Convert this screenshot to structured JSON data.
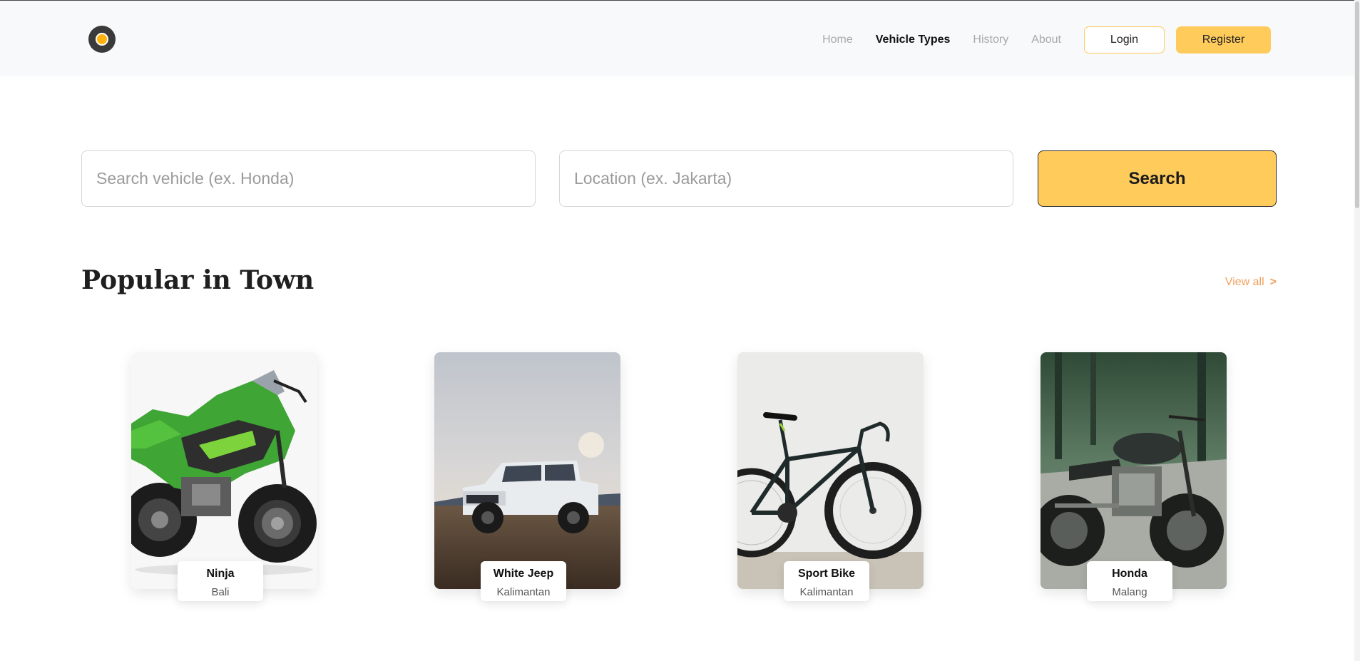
{
  "nav": {
    "items": [
      {
        "label": "Home",
        "active": false
      },
      {
        "label": "Vehicle Types",
        "active": true
      },
      {
        "label": "History",
        "active": false
      },
      {
        "label": "About",
        "active": false
      }
    ],
    "login_label": "Login",
    "register_label": "Register"
  },
  "search": {
    "vehicle_placeholder": "Search vehicle (ex. Honda)",
    "vehicle_value": "",
    "location_placeholder": "Location (ex. Jakarta)",
    "location_value": "",
    "button_label": "Search"
  },
  "popular": {
    "title": "Popular in Town",
    "view_all_label": "View all",
    "view_all_icon": "chevron-right-icon",
    "view_all_glyph": ">",
    "cards": [
      {
        "name": "Ninja",
        "location": "Bali",
        "image": "green-sport-motorcycle"
      },
      {
        "name": "White Jeep",
        "location": "Kalimantan",
        "image": "white-jeep-in-field"
      },
      {
        "name": "Sport Bike",
        "location": "Kalimantan",
        "image": "road-bicycle-against-wall"
      },
      {
        "name": "Honda",
        "location": "Malang",
        "image": "cafe-racer-motorcycle-in-forest"
      }
    ]
  },
  "colors": {
    "accent": "#ffcb5b",
    "link_orange": "#f0a05c",
    "header_bg": "#f8f9fa",
    "nav_inactive": "#a9a9a9"
  },
  "icons": {
    "logo": "logo-circle-icon"
  }
}
